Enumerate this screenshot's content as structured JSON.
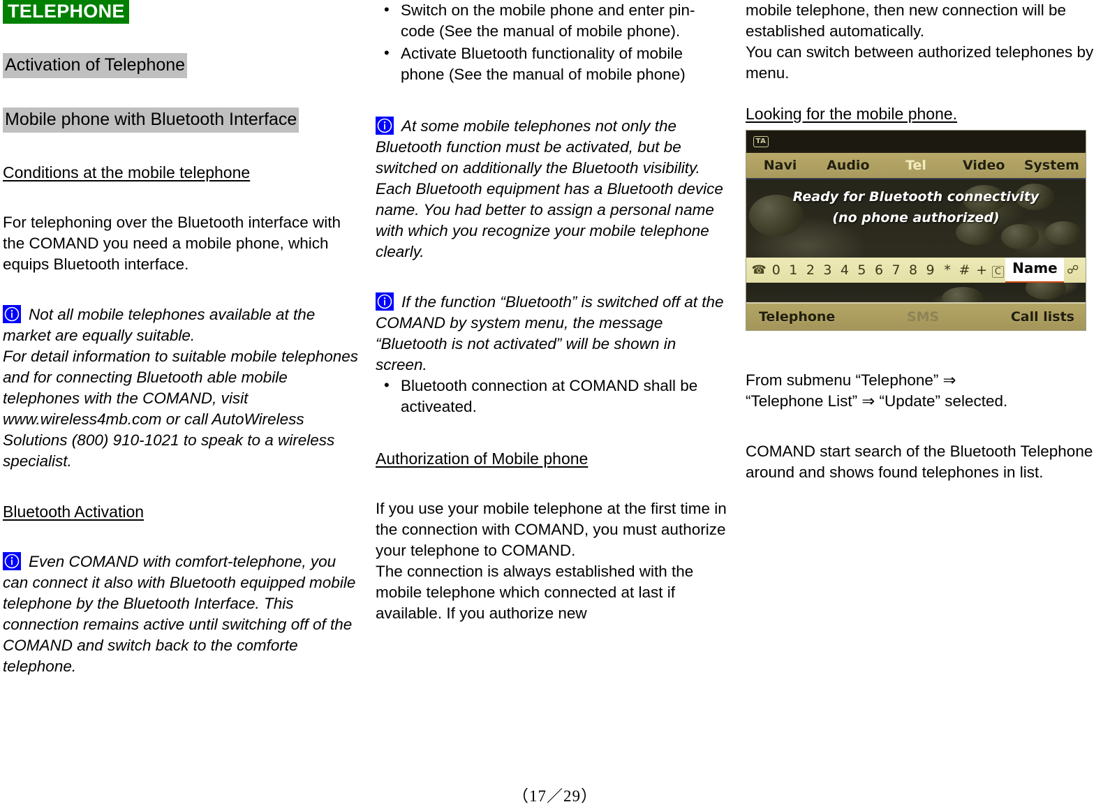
{
  "document": {
    "title": "TELEPHONE",
    "page_footer": "（17／29）"
  },
  "left_column": {
    "heading_activation": "Activation of Telephone",
    "heading_mobile_bt": "Mobile phone with Bluetooth Interface",
    "heading_conditions": "Conditions at the mobile telephone",
    "para_requirements": "For telephoning over the Bluetooth interface with the COMAND you need a mobile phone, which equips Bluetooth interface.",
    "note_suitable_1": "Not all mobile telephones available at the market are equally suitable.",
    "note_suitable_2": "For detail information to suitable mobile telephones and for connecting Bluetooth able mobile telephones with the COMAND, visit www.wireless4mb.com or call AutoWireless Solutions (800) 910-1021 to speak to a wireless specialist.",
    "heading_bt_activation": "Bluetooth Activation",
    "note_comfort": "Even COMAND with comfort-telephone, you can connect it also with Bluetooth equipped mobile telephone by the Bluetooth Interface. This connection remains active until switching off of the COMAND and switch back to the comforte telephone."
  },
  "middle_column": {
    "bullets_top": [
      "Switch on the mobile phone and enter pin-code (See the manual of mobile phone).",
      "Activate Bluetooth functionality of mobile phone (See the manual of mobile phone)"
    ],
    "note_visibility": "At some mobile telephones not only the Bluetooth function must be activated, but be switched on additionally the Bluetooth visibility. Each Bluetooth equipment has a Bluetooth device name. You had better to assign a personal name with which you recognize your mobile telephone clearly.",
    "note_switched_off": "If the function “Bluetooth” is switched off at the COMAND by system menu, the message “Bluetooth is not activated” will be shown in screen.",
    "bullets_bottom": [
      "Bluetooth connection at COMAND shall be activeated."
    ],
    "heading_authorization": "Authorization of Mobile phone",
    "para_first_time": "If you use your mobile telephone at the first time in the connection with COMAND, you must authorize your telephone to COMAND.",
    "para_connection": "The connection is always established with the mobile telephone which connected at last if available. If you authorize new"
  },
  "right_column": {
    "para_continued": "mobile telephone, then new connection will be established automatically.",
    "para_switch": "You can switch between authorized telephones by menu.",
    "heading_looking": "Looking for the mobile phone.",
    "para_submenu_line1": "From submenu “Telephone” ⇒",
    "para_submenu_line2": "“Telephone List” ⇒ “Update”  selected.",
    "para_search": "COMAND start search of the Bluetooth Telephone around and shows found telephones in list."
  },
  "comand_screen": {
    "status_badge": "TA",
    "menu_items": [
      {
        "label": "Navi",
        "active": false
      },
      {
        "label": "Audio",
        "active": false
      },
      {
        "label": "Tel",
        "active": true
      },
      {
        "label": "Video",
        "active": false
      },
      {
        "label": "System",
        "active": false
      }
    ],
    "message_line1": "Ready for Bluetooth connectivity",
    "message_line2": "(no phone authorized)",
    "keypad": [
      "0",
      "1",
      "2",
      "3",
      "4",
      "5",
      "6",
      "7",
      "8",
      "9",
      "*",
      "#",
      "+"
    ],
    "keypad_hangup_icon": "hangup-icon",
    "keypad_clear_label": "C",
    "keypad_name_button": "Name",
    "keypad_call_icon": "call-icon",
    "bottom_items": [
      {
        "label": "Telephone",
        "dimmed": false
      },
      {
        "label": "SMS",
        "dimmed": true
      },
      {
        "label": "Call lists",
        "dimmed": false
      }
    ]
  },
  "colors": {
    "title_bg": "#008000",
    "title_fg": "#ffffff",
    "heading_highlight": "#c0c0c0",
    "info_icon_bg": "#0000ff",
    "comand_menu_bg": "#b8a96a",
    "comand_keypad_bg": "#eeeab8",
    "comand_active_item": "#f2ecc0",
    "name_button_underline": "#cc4b12"
  }
}
